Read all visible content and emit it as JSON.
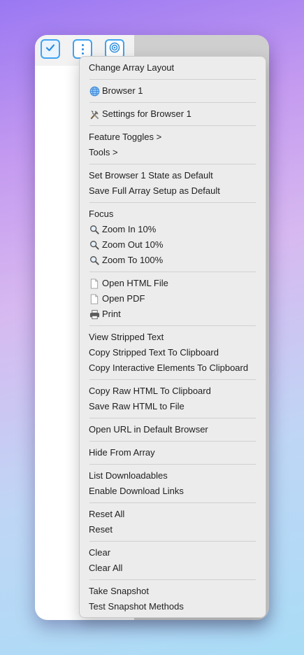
{
  "colors": {
    "accent": "#3fa3f0",
    "menu_bg": "#ececec",
    "separator": "#d0d0d0"
  },
  "toolbar": {
    "buttons": [
      {
        "icon": "checkmark-icon"
      },
      {
        "icon": "vertical-dots-icon"
      },
      {
        "icon": "target-icon"
      }
    ]
  },
  "menu": {
    "change_layout": "Change Array Layout",
    "browser": "Browser 1",
    "settings": "Settings for Browser 1",
    "feature_toggles": "Feature Toggles >",
    "tools": "Tools >",
    "set_state_default": "Set Browser 1 State as Default",
    "save_setup_default": "Save Full Array Setup as Default",
    "focus": "Focus",
    "zoom_in": "Zoom In 10%",
    "zoom_out": "Zoom Out 10%",
    "zoom_to": "Zoom To 100%",
    "open_html": "Open HTML File",
    "open_pdf": "Open PDF",
    "print": "Print",
    "view_stripped": "View Stripped Text",
    "copy_stripped": "Copy Stripped Text To Clipboard",
    "copy_interactive": "Copy Interactive Elements To Clipboard",
    "copy_raw_html": "Copy Raw HTML To Clipboard",
    "save_raw_html": "Save Raw HTML to File",
    "open_url": "Open URL in Default Browser",
    "hide": "Hide From Array",
    "list_downloadables": "List Downloadables",
    "enable_download_links": "Enable Download Links",
    "reset_all": "Reset All",
    "reset": "Reset",
    "clear": "Clear",
    "clear_all": "Clear All",
    "take_snapshot": "Take Snapshot",
    "test_snapshot": "Test Snapshot Methods"
  }
}
